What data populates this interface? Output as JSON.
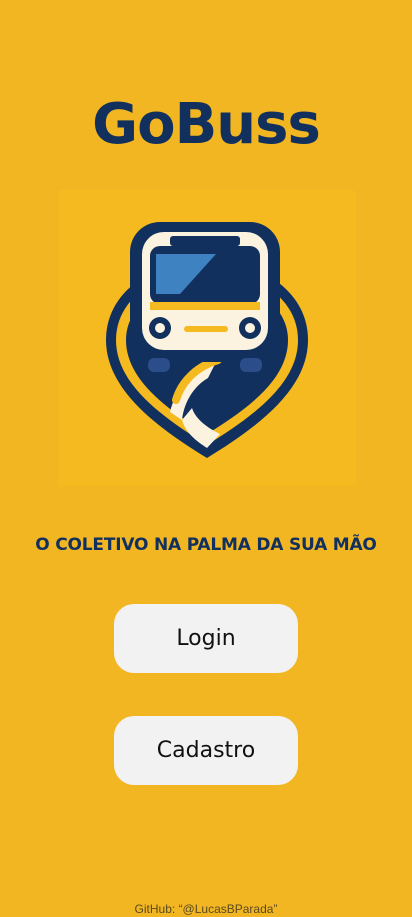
{
  "app": {
    "title": "GoBuss",
    "tagline": "O COLETIVO NA PALMA DA SUA MÃO"
  },
  "buttons": {
    "login_label": "Login",
    "signup_label": "Cadastro"
  },
  "footer": {
    "credit": "GitHub: “@LucasBParada”"
  },
  "logo": {
    "icon": "bus-location-pin-icon"
  },
  "colors": {
    "background": "#F2B622",
    "primary_navy": "#11305D",
    "button_bg": "#F2F2F2",
    "logo_yellow": "#F5BA1F",
    "logo_cream": "#FBF3E0",
    "windshield_blue": "#3F82C1",
    "footer_text": "#5A4A1E"
  }
}
